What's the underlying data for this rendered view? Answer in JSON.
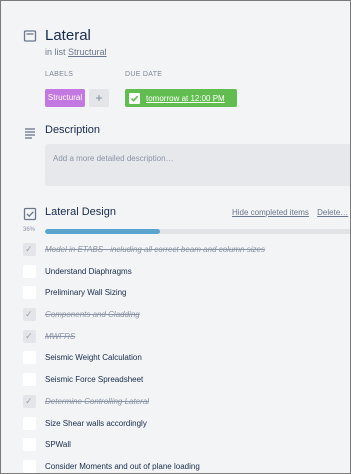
{
  "card": {
    "title": "Lateral",
    "in_list_prefix": "in list",
    "list_name": "Structural",
    "icon": "card-icon"
  },
  "labels": {
    "heading": "LABELS",
    "items": [
      {
        "text": "Structural",
        "color": "#c377e0"
      }
    ],
    "add": "+"
  },
  "due": {
    "heading": "DUE DATE",
    "text": "tomorrow at 12:00 PM",
    "color": "#61bd4f",
    "checked": true
  },
  "description": {
    "title": "Description",
    "placeholder": "Add a more detailed description…",
    "icon": "description-icon"
  },
  "checklist": {
    "title": "Lateral Design",
    "hide_completed": "Hide completed items",
    "delete": "Delete…",
    "progress_label": "36%",
    "progress": 0.36,
    "icon": "checklist-icon",
    "items": [
      {
        "text": "Model in ETABS - including all correct beam and column sizes",
        "done": true
      },
      {
        "text": "Understand Diaphragms",
        "done": false
      },
      {
        "text": "Preliminary Wall Sizing",
        "done": false
      },
      {
        "text": "Components and Cladding",
        "done": true
      },
      {
        "text": "MWFRS",
        "done": true
      },
      {
        "text": "Seismic Weight Calculation",
        "done": false
      },
      {
        "text": "Seismic Force Spreadsheet",
        "done": false
      },
      {
        "text": "Determine Controlling Lateral",
        "done": true
      },
      {
        "text": "Size Shear walls accordingly",
        "done": false
      },
      {
        "text": "SPWall",
        "done": false
      },
      {
        "text": "Consider Moments and out of plane loading",
        "done": false
      }
    ]
  }
}
